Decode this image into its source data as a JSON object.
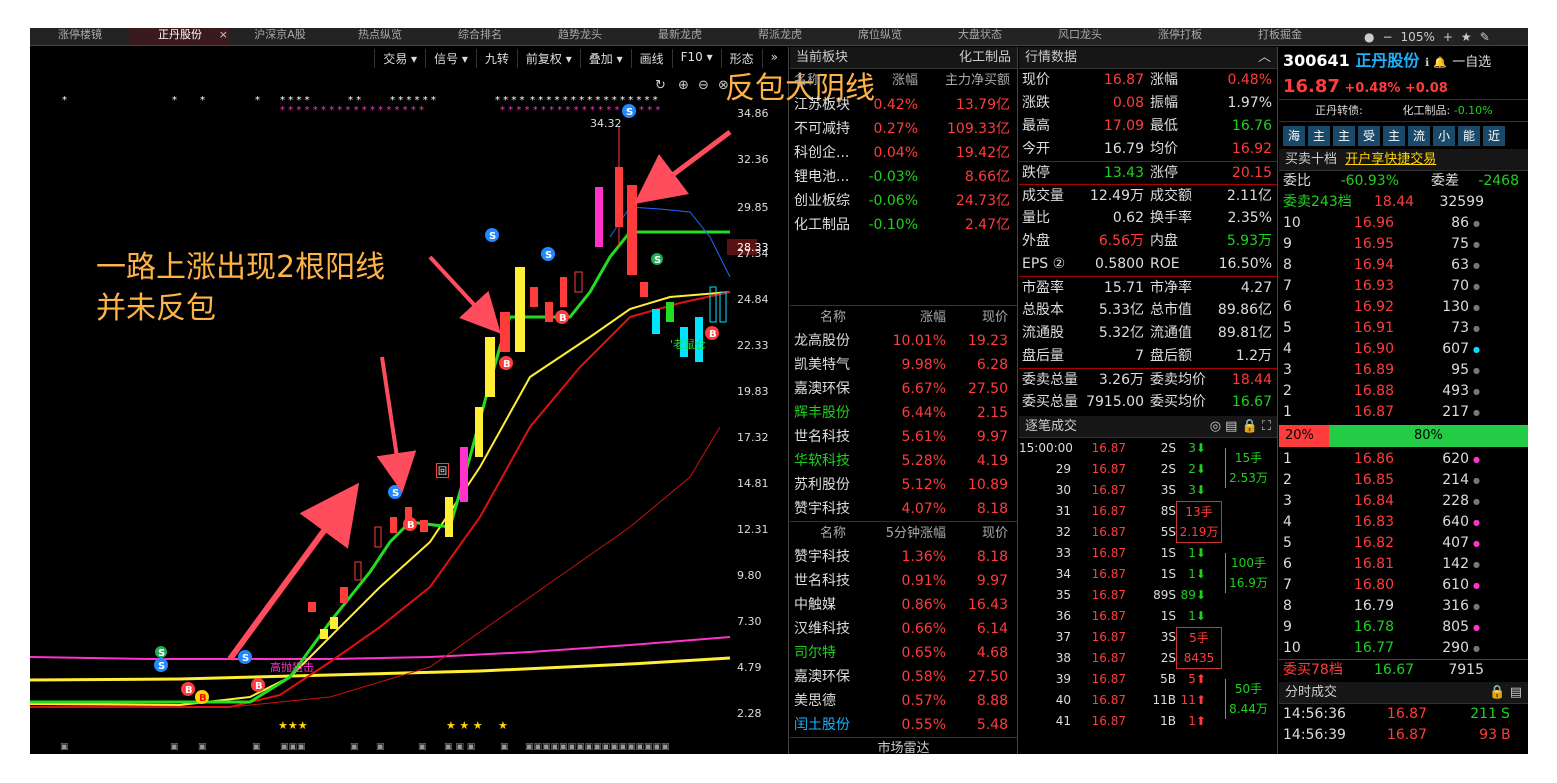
{
  "tabs": [
    "涨停楼镜",
    "正丹股份",
    "沪深京A股",
    "热点纵览",
    "综合排名",
    "趋势龙头",
    "最新龙虎",
    "帮派龙虎",
    "席位纵览",
    "大盘状态",
    "风口龙头",
    "涨停打板",
    "打板掘金"
  ],
  "tab_right": {
    "zoom": "105%"
  },
  "toolbar": [
    "交易 ▾",
    "信号 ▾",
    "九转",
    "前复权 ▾",
    "叠加 ▾",
    "画线",
    "F10 ▾",
    "形态",
    "»"
  ],
  "chart": {
    "annotation_top": "反包大阴线",
    "annotation_left_1": "一路上涨出现2根阳线",
    "annotation_left_2": "并未反包",
    "yticks": [
      "34.86",
      "32.36",
      "29.85",
      "27.34",
      "24.84",
      "22.33",
      "19.83",
      "17.32",
      "14.81",
      "12.31",
      "9.80",
      "7.30",
      "4.79",
      "2.28"
    ],
    "current_price": "28.33",
    "high_label": "34.32",
    "sig_label": "'老鼠仓",
    "low_label": "高抛狙击",
    "zi_label": "回"
  },
  "sector": {
    "header": "当前板块",
    "header_right": "化工制品",
    "cols": [
      "名称",
      "涨幅",
      "主力净买额"
    ],
    "rows": [
      [
        "江苏板块",
        "0.42%",
        "13.79亿"
      ],
      [
        "不可减持",
        "0.27%",
        "109.33亿"
      ],
      [
        "科创企...",
        "0.04%",
        "19.42亿"
      ],
      [
        "锂电池...",
        "-0.03%",
        "8.66亿"
      ],
      [
        "创业板综",
        "-0.06%",
        "24.73亿"
      ],
      [
        "化工制品",
        "-0.10%",
        "2.47亿"
      ]
    ]
  },
  "rank1": {
    "cols": [
      "名称",
      "涨幅",
      "现价"
    ],
    "rows": [
      [
        "龙高股份",
        "10.01%",
        "19.23",
        "w"
      ],
      [
        "凯美特气",
        "9.98%",
        "6.28",
        "w"
      ],
      [
        "嘉澳环保",
        "6.67%",
        "27.50",
        "w"
      ],
      [
        "辉丰股份",
        "6.44%",
        "2.15",
        "g"
      ],
      [
        "世名科技",
        "5.61%",
        "9.97",
        "w"
      ],
      [
        "华软科技",
        "5.28%",
        "4.19",
        "g"
      ],
      [
        "苏利股份",
        "5.12%",
        "10.89",
        "w"
      ],
      [
        "赞宇科技",
        "4.07%",
        "8.18",
        "w"
      ]
    ]
  },
  "rank2": {
    "cols": [
      "名称",
      "5分钟涨幅",
      "现价"
    ],
    "rows": [
      [
        "赞宇科技",
        "1.36%",
        "8.18",
        "w"
      ],
      [
        "世名科技",
        "0.91%",
        "9.97",
        "w"
      ],
      [
        "中触媒",
        "0.86%",
        "16.43",
        "w"
      ],
      [
        "汉维科技",
        "0.66%",
        "6.14",
        "w"
      ],
      [
        "司尔特",
        "0.65%",
        "4.68",
        "g"
      ],
      [
        "嘉澳环保",
        "0.58%",
        "27.50",
        "w"
      ],
      [
        "美思德",
        "0.57%",
        "8.88",
        "w"
      ],
      [
        "闰土股份",
        "0.55%",
        "5.48",
        "c"
      ]
    ]
  },
  "radar": "市场雷达",
  "quote": {
    "header": "行情数据",
    "rows": [
      [
        "现价",
        "16.87",
        "r",
        "涨幅",
        "0.48%",
        "r"
      ],
      [
        "涨跌",
        "0.08",
        "r",
        "振幅",
        "1.97%",
        "w"
      ],
      [
        "最高",
        "17.09",
        "r",
        "最低",
        "16.76",
        "g"
      ],
      [
        "今开",
        "16.79",
        "w",
        "均价",
        "16.92",
        "r"
      ],
      [
        "跌停",
        "13.43",
        "g",
        "涨停",
        "20.15",
        "r"
      ],
      [
        "成交量",
        "12.49万",
        "w",
        "成交额",
        "2.11亿",
        "w"
      ],
      [
        "量比",
        "0.62",
        "w",
        "换手率",
        "2.35%",
        "w"
      ],
      [
        "外盘",
        "6.56万",
        "r",
        "内盘",
        "5.93万",
        "g"
      ],
      [
        "EPS ②",
        "0.5800",
        "w",
        "ROE",
        "16.50%",
        "w"
      ],
      [
        "市盈率",
        "15.71",
        "w",
        "市净率",
        "4.27",
        "w"
      ],
      [
        "总股本",
        "5.33亿",
        "w",
        "总市值",
        "89.86亿",
        "w"
      ],
      [
        "流通股",
        "5.32亿",
        "w",
        "流通值",
        "89.81亿",
        "w"
      ],
      [
        "盘后量",
        "7",
        "w",
        "盘后额",
        "1.2万",
        "w"
      ],
      [
        "委卖总量",
        "3.26万",
        "w",
        "委卖均价",
        "18.44",
        "r"
      ],
      [
        "委买总量",
        "7915.00",
        "w",
        "委买均价",
        "16.67",
        "g"
      ]
    ]
  },
  "ticks": {
    "header": "逐笔成交",
    "rows": [
      [
        "15:00:00",
        "16.87",
        "2S",
        "3⬇",
        "g"
      ],
      [
        "29",
        "16.87",
        "2S",
        "2⬇",
        "g"
      ],
      [
        "30",
        "16.87",
        "3S",
        "3⬇",
        "g"
      ],
      [
        "31",
        "16.87",
        "8S",
        "",
        "g"
      ],
      [
        "32",
        "16.87",
        "5S",
        "",
        "g"
      ],
      [
        "33",
        "16.87",
        "1S",
        "1⬇",
        "g"
      ],
      [
        "34",
        "16.87",
        "1S",
        "1⬇",
        "g"
      ],
      [
        "35",
        "16.87",
        "89S",
        "89⬇",
        "g"
      ],
      [
        "36",
        "16.87",
        "1S",
        "1⬇",
        "g"
      ],
      [
        "37",
        "16.87",
        "3S",
        "",
        "g"
      ],
      [
        "38",
        "16.87",
        "2S",
        "",
        "g"
      ],
      [
        "39",
        "16.87",
        "5B",
        "5⬆",
        "r"
      ],
      [
        "40",
        "16.87",
        "11B",
        "11⬆",
        "r"
      ],
      [
        "41",
        "16.87",
        "1B",
        "1⬆",
        "r"
      ]
    ],
    "boxes": [
      [
        "13手",
        "2.19万"
      ],
      [
        "5手",
        "8435"
      ]
    ],
    "side": [
      [
        "15手",
        "2.53万"
      ],
      [
        "100手",
        "16.9万"
      ],
      [
        "50手",
        "8.44万"
      ]
    ]
  },
  "stock": {
    "code": "300641",
    "name": "正丹股份",
    "watch": "一自选",
    "price": "16.87",
    "chg": "+0.48%",
    "chg_abs": "+0.08",
    "sub_left": "正丹转债:",
    "sub_right": "化工制品:",
    "sub_val": "-0.10%",
    "buttons": [
      "海",
      "主",
      "主",
      "受",
      "主",
      "流",
      "小",
      "能",
      "近"
    ],
    "book_header": "买卖十档",
    "book_link": "开户享快捷交易",
    "ratio": [
      "委比",
      "-60.93%",
      "委差",
      "-2468"
    ],
    "sell_total": [
      "委卖243档",
      "18.44",
      "32599"
    ],
    "sells": [
      [
        "10",
        "16.96",
        "86"
      ],
      [
        "9",
        "16.95",
        "75"
      ],
      [
        "8",
        "16.94",
        "63"
      ],
      [
        "7",
        "16.93",
        "70"
      ],
      [
        "6",
        "16.92",
        "130"
      ],
      [
        "5",
        "16.91",
        "73"
      ],
      [
        "4",
        "16.90",
        "607"
      ],
      [
        "3",
        "16.89",
        "95"
      ],
      [
        "2",
        "16.88",
        "493"
      ],
      [
        "1",
        "16.87",
        "217"
      ]
    ],
    "bar": [
      "20%",
      "80%"
    ],
    "buys": [
      [
        "1",
        "16.86",
        "620"
      ],
      [
        "2",
        "16.85",
        "214"
      ],
      [
        "3",
        "16.84",
        "228"
      ],
      [
        "4",
        "16.83",
        "640"
      ],
      [
        "5",
        "16.82",
        "407"
      ],
      [
        "6",
        "16.81",
        "142"
      ],
      [
        "7",
        "16.80",
        "610"
      ],
      [
        "8",
        "16.79",
        "316"
      ],
      [
        "9",
        "16.78",
        "805"
      ],
      [
        "10",
        "16.77",
        "290"
      ]
    ],
    "buy_total": [
      "委买78档",
      "16.67",
      "7915"
    ],
    "trades_header": "分时成交",
    "trades": [
      [
        "14:56:36",
        "16.87",
        "211",
        "S"
      ],
      [
        "14:56:39",
        "16.87",
        "93",
        "B"
      ]
    ]
  },
  "colors": {
    "up": "#ff3c3c",
    "down": "#1fd11f",
    "accent": "#ffb347"
  }
}
